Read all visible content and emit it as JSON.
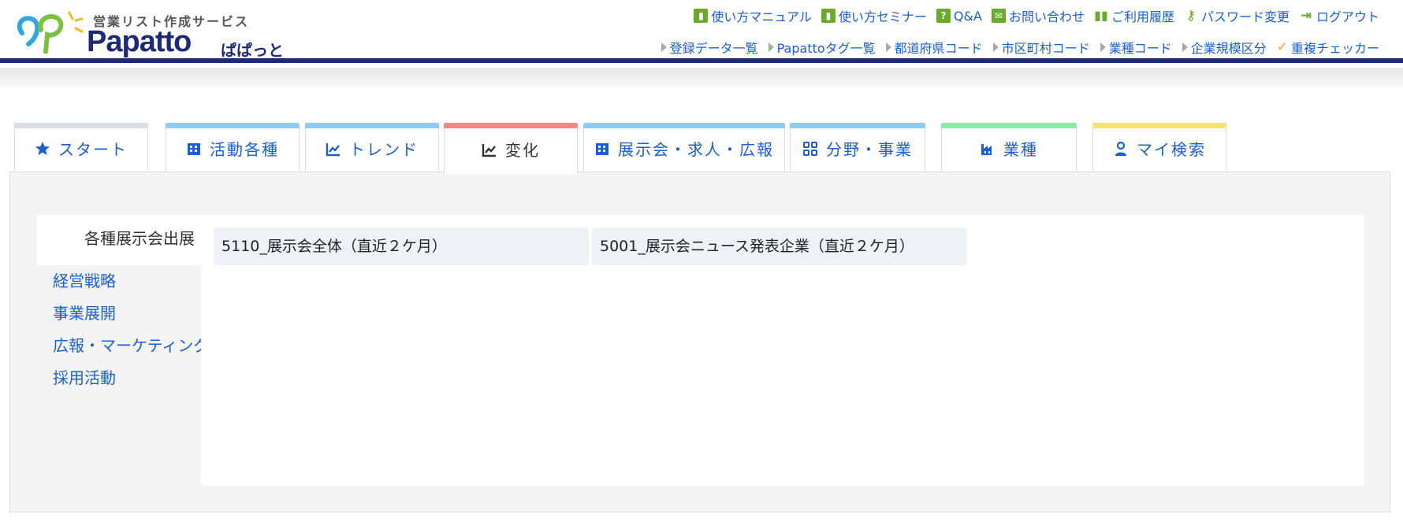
{
  "logo": {
    "tagline": "営業リスト作成サービス",
    "name": "Papatto",
    "kana": "ぱぱっと"
  },
  "top_nav": [
    {
      "label": "使い方マニュアル",
      "icon": "book-icon"
    },
    {
      "label": "使い方セミナー",
      "icon": "book-icon"
    },
    {
      "label": "Q&A",
      "icon": "question-icon"
    },
    {
      "label": "お問い合わせ",
      "icon": "mail-icon"
    },
    {
      "label": "ご利用履歴",
      "icon": "history-icon"
    },
    {
      "label": "パスワード変更",
      "icon": "key-icon"
    },
    {
      "label": "ログアウト",
      "icon": "logout-icon"
    }
  ],
  "sub_nav": [
    {
      "label": "登録データ一覧"
    },
    {
      "label": "Papattoタグ一覧"
    },
    {
      "label": "都道府県コード"
    },
    {
      "label": "市区町村コード"
    },
    {
      "label": "業種コード"
    },
    {
      "label": "企業規模区分"
    },
    {
      "label": "重複チェッカー"
    }
  ],
  "tabs": [
    {
      "label": "スタート",
      "icon": "star-icon",
      "bar_color": "#d9dee6"
    },
    {
      "label": "活動各種",
      "icon": "building-icon",
      "bar_color": "#92c9ef"
    },
    {
      "label": "トレンド",
      "icon": "trend-icon",
      "bar_color": "#92c9ef"
    },
    {
      "label": "変化",
      "icon": "chart-line-icon",
      "bar_color": "#f08a8a",
      "active": true
    },
    {
      "label": "展示会・求人・広報",
      "icon": "building-icon",
      "bar_color": "#92c9ef"
    },
    {
      "label": "分野・事業",
      "icon": "grid-icon",
      "bar_color": "#92c9ef"
    },
    {
      "label": "業種",
      "icon": "factory-icon",
      "bar_color": "#8ee8aa"
    },
    {
      "label": "マイ検索",
      "icon": "user-icon",
      "bar_color": "#f7e27a"
    }
  ],
  "sidebar": [
    {
      "label": "各種展示会出展",
      "active": true
    },
    {
      "label": "経営戦略"
    },
    {
      "label": "事業展開"
    },
    {
      "label": "広報・マーケティング"
    },
    {
      "label": "採用活動"
    }
  ],
  "cards": [
    {
      "label": "5110_展示会全体（直近２ケ月）"
    },
    {
      "label": "5001_展示会ニュース発表企業（直近２ケ月）"
    }
  ],
  "colors": {
    "accent_blue": "#1a5fd0",
    "header_bar": "#1e2a78",
    "icon_green": "#6aaa2a"
  }
}
